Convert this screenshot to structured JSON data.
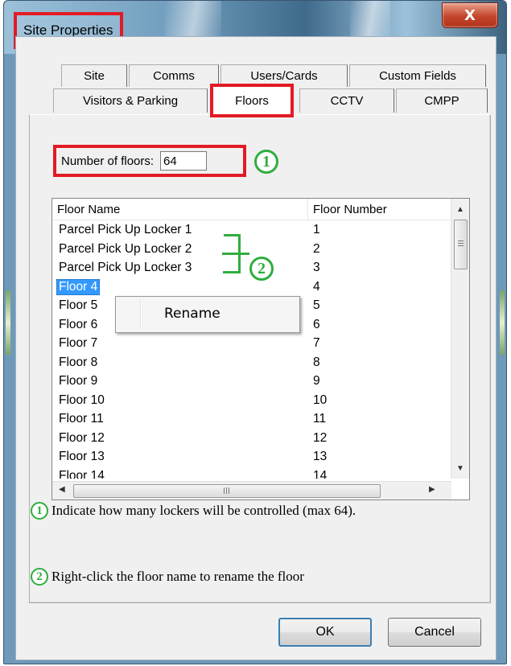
{
  "window": {
    "title": "Site Properties",
    "close_glyph": "X"
  },
  "tabs": {
    "row1": [
      "Site",
      "Comms",
      "Users/Cards",
      "Custom Fields"
    ],
    "row2": [
      "Visitors & Parking",
      "Floors",
      "CCTV",
      "CMPP"
    ],
    "selected": "Floors"
  },
  "floors_count": {
    "label": "Number of floors:",
    "value": "64"
  },
  "list": {
    "columns": [
      "Floor Name",
      "Floor Number"
    ],
    "rows": [
      {
        "name": "Parcel Pick Up Locker 1",
        "number": "1"
      },
      {
        "name": "Parcel Pick Up Locker 2",
        "number": "2"
      },
      {
        "name": "Parcel Pick Up Locker 3",
        "number": "3"
      },
      {
        "name": "Floor 4",
        "number": "4"
      },
      {
        "name": "Floor 5",
        "number": "5"
      },
      {
        "name": "Floor 6",
        "number": "6"
      },
      {
        "name": "Floor 7",
        "number": "7"
      },
      {
        "name": "Floor 8",
        "number": "8"
      },
      {
        "name": "Floor 9",
        "number": "9"
      },
      {
        "name": "Floor 10",
        "number": "10"
      },
      {
        "name": "Floor 11",
        "number": "11"
      },
      {
        "name": "Floor 12",
        "number": "12"
      },
      {
        "name": "Floor 13",
        "number": "13"
      },
      {
        "name": "Floor 14",
        "number": "14"
      }
    ],
    "selected_row": "Floor 4"
  },
  "context_menu": {
    "items": [
      "Rename"
    ]
  },
  "annotations": {
    "marker1": "1",
    "marker2": "2",
    "note1": "Indicate how many lockers will be controlled (max 64).",
    "note2": "Right-click the floor name to rename the floor"
  },
  "buttons": {
    "ok": "OK",
    "cancel": "Cancel"
  },
  "colors": {
    "highlight_red": "#e21b24",
    "annotation_green": "#2fae3e",
    "selection_blue": "#3399ff"
  }
}
